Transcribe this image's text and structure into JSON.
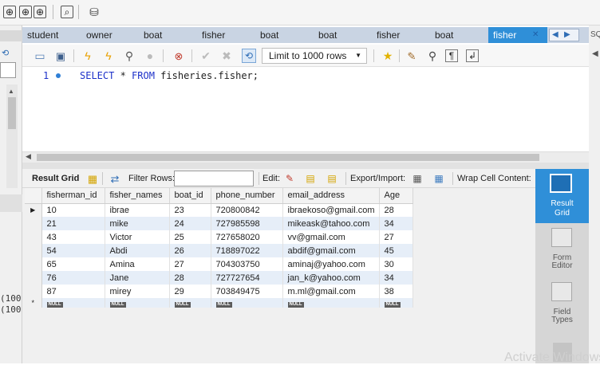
{
  "tabs": [
    {
      "label": "student",
      "active": false
    },
    {
      "label": "owner",
      "active": false
    },
    {
      "label": "boat",
      "active": false
    },
    {
      "label": "fisher",
      "active": false
    },
    {
      "label": "boat",
      "active": false
    },
    {
      "label": "boat",
      "active": false
    },
    {
      "label": "fisher",
      "active": false
    },
    {
      "label": "boat",
      "active": false
    },
    {
      "label": "fisher",
      "active": true
    }
  ],
  "tab_close": "✕",
  "right_edge_text": "SQ",
  "limit_select": {
    "value": "Limit to 1000 rows"
  },
  "editor": {
    "line_number": "1",
    "sql_keyword1": "SELECT",
    "sql_star": " * ",
    "sql_keyword2": "FROM",
    "sql_table": " fisheries.fisher;"
  },
  "result_toolbar": {
    "result_grid_label": "Result Grid",
    "filter_label": "Filter Rows:",
    "filter_value": "",
    "edit_label": "Edit:",
    "export_label": "Export/Import:",
    "wrap_label": "Wrap Cell Content:"
  },
  "grid": {
    "columns": [
      "fisherman_id",
      "fisher_names",
      "boat_id",
      "phone_number",
      "email_address",
      "Age"
    ],
    "rows": [
      [
        "10",
        "ibrae",
        "23",
        "720800842",
        "ibraekoso@gmail.com",
        "28"
      ],
      [
        "21",
        "mike",
        "24",
        "727985598",
        "mikeask@tahoo.com",
        "34"
      ],
      [
        "43",
        "Victor",
        "25",
        "727658020",
        "vv@gmail.com",
        "27"
      ],
      [
        "54",
        "Abdi",
        "26",
        "718897022",
        "abdif@gmail.com",
        "45"
      ],
      [
        "65",
        "Amina",
        "27",
        "704303750",
        "aminaj@yahoo.com",
        "30"
      ],
      [
        "76",
        "Jane",
        "28",
        "727727654",
        "jan_k@yahoo.com",
        "34"
      ],
      [
        "87",
        "mirey",
        "29",
        "703849475",
        "m.ml@gmail.com",
        "38"
      ]
    ],
    "new_row_marker": "*",
    "null_label": "NULL",
    "current_row_marker": "▶"
  },
  "left_fragments": [
    "(100",
    "(100"
  ],
  "side_panel": [
    {
      "label1": "Result",
      "label2": "Grid",
      "active": true
    },
    {
      "label1": "Form",
      "label2": "Editor",
      "active": false
    },
    {
      "label1": "Field",
      "label2": "Types",
      "active": false
    }
  ],
  "watermark": "Activate Windows"
}
